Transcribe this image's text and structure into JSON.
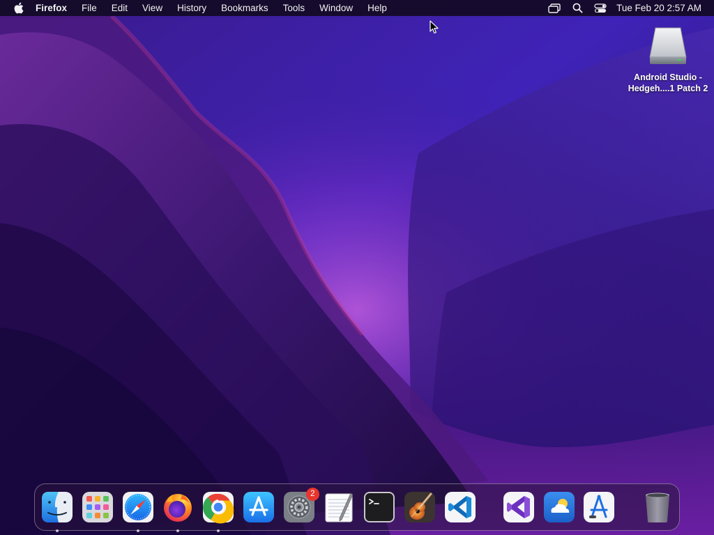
{
  "menubar": {
    "apple_icon": "apple-logo",
    "app_name": "Firefox",
    "items": [
      "File",
      "Edit",
      "View",
      "History",
      "Bookmarks",
      "Tools",
      "Window",
      "Help"
    ],
    "status_icons": [
      "screen-mirroring-icon",
      "spotlight-search-icon",
      "control-center-icon"
    ],
    "clock": "Tue Feb 20  2:57 AM"
  },
  "desktop": {
    "icons": [
      {
        "name": "drive-icon",
        "label_line1": "Android Studio -",
        "label_line2": "Hedgeh....1 Patch 2"
      }
    ]
  },
  "dock": {
    "apps": [
      {
        "name": "Finder",
        "icon": "finder-icon",
        "running": true
      },
      {
        "name": "Launchpad",
        "icon": "launchpad-icon",
        "running": false
      },
      {
        "name": "Safari",
        "icon": "safari-icon",
        "running": true
      },
      {
        "name": "Firefox",
        "icon": "firefox-icon",
        "running": true
      },
      {
        "name": "Google Chrome",
        "icon": "chrome-icon",
        "running": true
      },
      {
        "name": "App Store",
        "icon": "app-store-icon",
        "running": false
      },
      {
        "name": "System Preferences",
        "icon": "system-preferences-icon",
        "running": false,
        "badge": "2"
      },
      {
        "name": "TextEdit",
        "icon": "textedit-icon",
        "running": false
      },
      {
        "name": "Terminal",
        "icon": "terminal-icon",
        "running": false
      },
      {
        "name": "GarageBand",
        "icon": "garageband-icon",
        "running": false
      },
      {
        "name": "Visual Studio Code",
        "icon": "vscode-icon",
        "running": false
      },
      {
        "name": "Visual Studio",
        "icon": "visual-studio-icon",
        "running": false
      },
      {
        "name": "Weather",
        "icon": "weather-icon",
        "running": false
      },
      {
        "name": "Instruments",
        "icon": "instruments-icon",
        "running": false
      },
      {
        "name": "Trash",
        "icon": "trash-icon",
        "running": false
      }
    ]
  },
  "colors": {
    "wallpaper_base": "#2a0e5a",
    "wallpaper_highlight": "#8a3fd6",
    "badge": "#e8352e"
  }
}
